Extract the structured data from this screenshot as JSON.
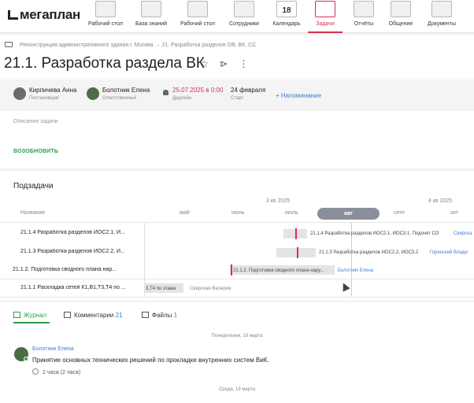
{
  "app": {
    "logo": "мегаплан"
  },
  "nav": [
    {
      "label": "Рабочий стол",
      "icon": "desktop-icon"
    },
    {
      "label": "База знаний",
      "icon": "book-icon"
    },
    {
      "label": "Рабочий стол",
      "icon": "desktop-icon"
    },
    {
      "label": "Сотрудники",
      "icon": "people-icon"
    },
    {
      "label": "Календарь",
      "icon": "calendar-icon",
      "day": "18"
    },
    {
      "label": "Задачи",
      "icon": "tasks-icon",
      "active": true
    },
    {
      "label": "Отчёты",
      "icon": "chart-icon"
    },
    {
      "label": "Общение",
      "icon": "chat-icon"
    },
    {
      "label": "Документы",
      "icon": "folder-icon"
    }
  ],
  "breadcrumb": "Реконструкция административного здания г. Москва → 21. Разработка разделов ОВ, ВК, СС",
  "task": {
    "title": "21.1. Разработка раздела ВК",
    "star_icon": "☆",
    "tag_icon": "⊳",
    "more_icon": "⋮"
  },
  "people": {
    "owner": {
      "name": "Кирпичева Анна",
      "role": "Постановщик"
    },
    "responsible": {
      "name": "Болотник Елена",
      "role": "Ответственный"
    },
    "deadline": {
      "value": "25.07.2025 в 0:00",
      "label": "Дедлайн",
      "color": "#d9304f"
    },
    "start": {
      "value": "24 февраля",
      "label": "Старт"
    },
    "reminder": "+ Напоминание"
  },
  "description_placeholder": "Описание задачи",
  "resume_label": "ВОЗОБНОВИТЬ",
  "subtasks": {
    "title": "Подзадачи",
    "name_header": "Название",
    "quarters": [
      "3 кв 2025",
      "4 кв 2025"
    ],
    "months": [
      "май",
      "июнь",
      "июль",
      "авг",
      "сент",
      "окт"
    ],
    "selected_month": "авг",
    "rows": [
      {
        "name": "21.1.4 Разработка разделов ИОС2.1, И...",
        "bar_text": "21.1.4 Разработка разделов ИОС2.1, ИОС3.1. Подочет СО",
        "user": "Свирска"
      },
      {
        "name": "21.1.3 Разработка разделов ИОС2.2, И...",
        "bar_text": "21.1.3 Разработка разделов ИОС2.2, ИОС3.2",
        "user": "Горенский Влади"
      },
      {
        "name": "21.1.2. Подготовка сводного плана нар...",
        "bar_text": "21.1.2. Подготовка сводного плана нару...",
        "user": "Болотник Елена"
      },
      {
        "name": "21.1.1 Раскладка сетей К1,В1,Т3,Т4 по ...",
        "bar_text": "3,Т4 по этажа",
        "user": "Свирская Валерия"
      }
    ]
  },
  "tabs": {
    "journal": "Журнал",
    "comments": "Комментарии",
    "comments_count": "21",
    "files": "Файлы",
    "files_count": "1"
  },
  "feed": {
    "date1": "Понедельник, 10 марта",
    "author": "Болотник Елена",
    "message": "Принятие основных технических решений по прокладке внутренних систем ВиК.",
    "duration": "2 часа (2 часа)",
    "date2": "Среда, 19 марта"
  },
  "colors": {
    "accent": "#d9304f",
    "green": "#2e9e48",
    "link": "#3d7fd6"
  }
}
